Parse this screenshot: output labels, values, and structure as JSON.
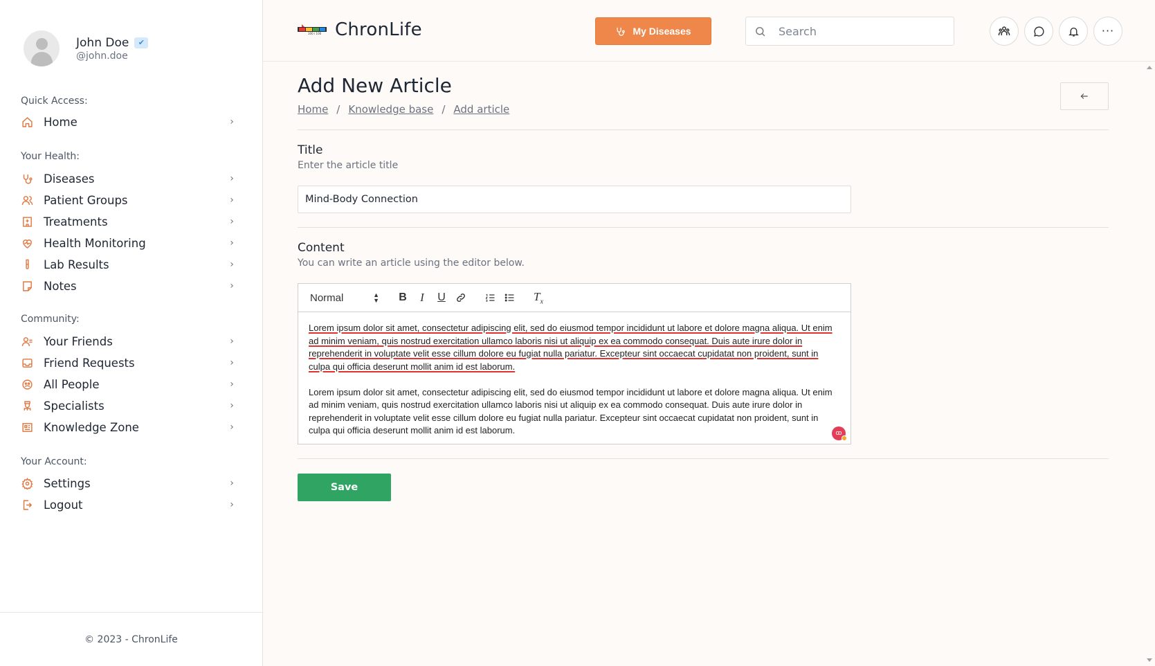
{
  "user": {
    "name": "John Doe",
    "handle": "@john.doe"
  },
  "sidebar": {
    "sections": [
      {
        "label": "Quick Access:",
        "items": [
          {
            "label": "Home",
            "icon": "home-icon"
          }
        ]
      },
      {
        "label": "Your Health:",
        "items": [
          {
            "label": "Diseases",
            "icon": "stethoscope-icon"
          },
          {
            "label": "Patient Groups",
            "icon": "users-icon"
          },
          {
            "label": "Treatments",
            "icon": "hospital-icon"
          },
          {
            "label": "Health Monitoring",
            "icon": "heart-pulse-icon"
          },
          {
            "label": "Lab Results",
            "icon": "test-tube-icon"
          },
          {
            "label": "Notes",
            "icon": "note-icon"
          }
        ]
      },
      {
        "label": "Community:",
        "items": [
          {
            "label": "Your Friends",
            "icon": "user-check-icon"
          },
          {
            "label": "Friend Requests",
            "icon": "inbox-icon"
          },
          {
            "label": "All People",
            "icon": "globe-people-icon"
          },
          {
            "label": "Specialists",
            "icon": "doctor-icon"
          },
          {
            "label": "Knowledge Zone",
            "icon": "newspaper-icon"
          }
        ]
      },
      {
        "label": "Your Account:",
        "items": [
          {
            "label": "Settings",
            "icon": "gear-icon"
          },
          {
            "label": "Logout",
            "icon": "logout-icon"
          }
        ]
      }
    ],
    "footer": "© 2023 - ChronLife"
  },
  "header": {
    "brand": "ChronLife",
    "logo_caption": "100 / 100",
    "my_diseases_label": "My Diseases",
    "search_placeholder": "Search"
  },
  "page": {
    "title": "Add New Article",
    "breadcrumb": [
      "Home",
      "Knowledge base",
      "Add article"
    ]
  },
  "form": {
    "title_label": "Title",
    "title_help": "Enter the article title",
    "title_value": "Mind-Body Connection",
    "content_label": "Content",
    "content_help": "You can write an article using the editor below.",
    "editor_format": "Normal",
    "paragraphs": [
      "Lorem ipsum dolor sit amet, consectetur adipiscing elit, sed do eiusmod tempor incididunt ut labore et dolore magna aliqua. Ut enim ad minim veniam, quis nostrud exercitation ullamco laboris nisi ut aliquip ex ea commodo consequat. Duis aute irure dolor in reprehenderit in voluptate velit esse cillum dolore eu fugiat nulla pariatur. Excepteur sint occaecat cupidatat non proident, sunt in culpa qui officia deserunt mollit anim id est laborum.",
      "Lorem ipsum dolor sit amet, consectetur adipiscing elit, sed do eiusmod tempor incididunt ut labore et dolore magna aliqua. Ut enim ad minim veniam, quis nostrud exercitation ullamco laboris nisi ut aliquip ex ea commodo consequat. Duis aute irure dolor in reprehenderit in voluptate velit esse cillum dolore eu fugiat nulla pariatur. Excepteur sint occaecat cupidatat non proident, sunt in culpa qui officia deserunt mollit anim id est laborum."
    ],
    "save_label": "Save"
  },
  "colors": {
    "accent": "#f0874a",
    "icon": "#e0763f",
    "save": "#2fa463"
  }
}
